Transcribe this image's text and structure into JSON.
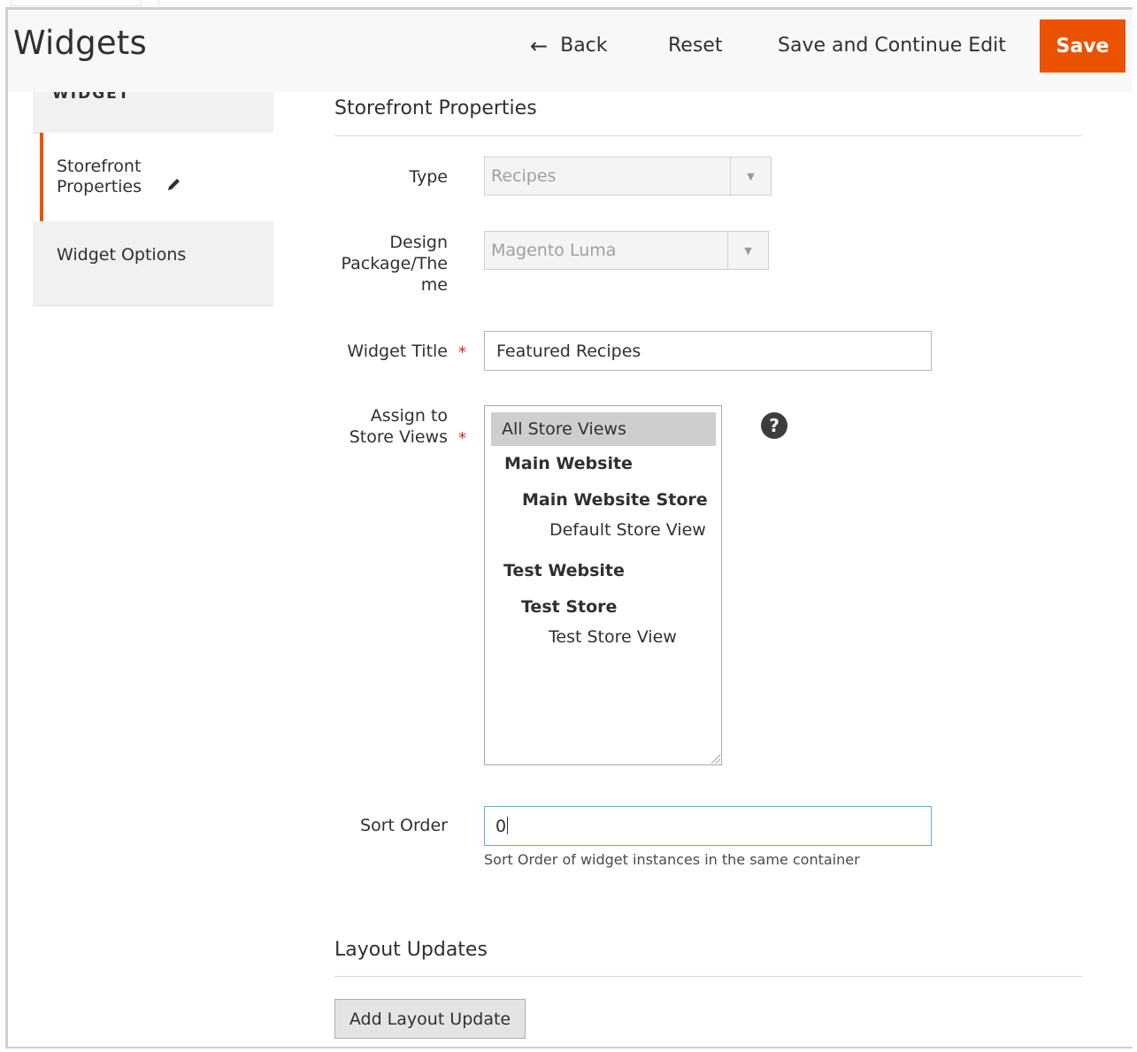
{
  "header": {
    "title": "Widgets",
    "back_label": "Back",
    "reset_label": "Reset",
    "save_continue_label": "Save and Continue Edit",
    "save_label": "Save"
  },
  "sidebar": {
    "top_label": "WIDGET",
    "items": [
      {
        "label": "Storefront Properties",
        "active": true
      },
      {
        "label": "Widget Options",
        "active": false
      }
    ]
  },
  "storefront": {
    "section_title": "Storefront Properties",
    "type_label": "Type",
    "type_value": "Recipes",
    "design_label": "Design Package/The me",
    "design_value": "Magento Luma",
    "title_label": "Widget Title",
    "title_value": "Featured Recipes",
    "store_views_label": "Assign to Store Views",
    "store_views": [
      {
        "label": "All Store Views",
        "selected": true,
        "bold": false
      },
      {
        "label": "Main Website",
        "selected": false,
        "bold": true
      },
      {
        "label": "Main Website Store",
        "selected": false,
        "bold": true
      },
      {
        "label": "Default Store View",
        "selected": false,
        "bold": false
      },
      {
        "label": "Test Website",
        "selected": false,
        "bold": true
      },
      {
        "label": "Test Store",
        "selected": false,
        "bold": true
      },
      {
        "label": "Test Store View",
        "selected": false,
        "bold": false
      }
    ],
    "help_icon": "?",
    "sort_label": "Sort Order",
    "sort_value": "0",
    "sort_note": "Sort Order of widget instances in the same container"
  },
  "layout": {
    "section_title": "Layout Updates",
    "add_button_label": "Add Layout Update"
  },
  "colors": {
    "accent": "#eb5202",
    "required": "#e22626"
  }
}
